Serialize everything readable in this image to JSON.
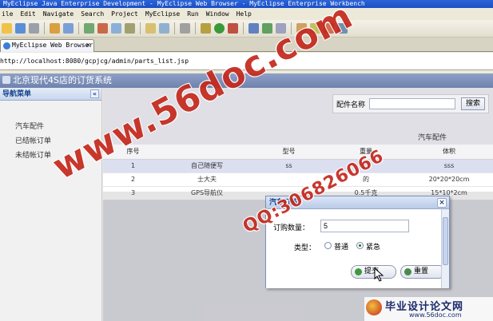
{
  "window": {
    "title": "MyEclipse Java Enterprise Development - MyEclipse Web Browser - MyEclipse Enterprise Workbench"
  },
  "menubar": [
    "ile",
    "Edit",
    "Navigate",
    "Search",
    "Project",
    "MyEclipse",
    "Run",
    "Window",
    "Help"
  ],
  "tab": {
    "label": "MyEclipse Web Browser"
  },
  "url": "http://localhost:8080/gcpjcg/admin/parts_list.jsp",
  "app": {
    "title": "北京现代4S店的订货系统"
  },
  "sidebar": {
    "title": "导航菜单",
    "items": [
      {
        "label": "汽车配件"
      },
      {
        "label": "已结帐订单"
      },
      {
        "label": "未结帐订单"
      }
    ]
  },
  "search": {
    "label": "配件名称",
    "value": "",
    "button": "搜索"
  },
  "grid": {
    "caption": "汽车配件",
    "columns": [
      "序号",
      "",
      "型号",
      "重量",
      "体积"
    ],
    "rows": [
      {
        "no": "1",
        "name": "自己随便写",
        "model": "ss",
        "weight": "ss",
        "volume": "sss"
      },
      {
        "no": "2",
        "name": "士大夫",
        "model": "",
        "weight": "的",
        "volume": "20*20*20cm"
      },
      {
        "no": "3",
        "name": "GPS导航仪",
        "model": "",
        "weight": "0.5千克",
        "volume": "15*10*2cm"
      }
    ]
  },
  "dialog": {
    "title": "汽车订购",
    "quantity_label": "订购数量：",
    "quantity_value": "5",
    "type_label": "类型：",
    "options": [
      {
        "label": "普通",
        "checked": false
      },
      {
        "label": "紧急",
        "checked": true
      }
    ],
    "submit_label": "提交",
    "reset_label": "重置"
  },
  "watermarks": {
    "site": "www.56doc.com",
    "qq": "QQ:306826066",
    "brand": "毕业设计论文网",
    "brand_url": "www.56doc.com"
  },
  "colors": {
    "header": "#6f82ad",
    "watermark": "#c4281c",
    "accent": "#15428b"
  }
}
